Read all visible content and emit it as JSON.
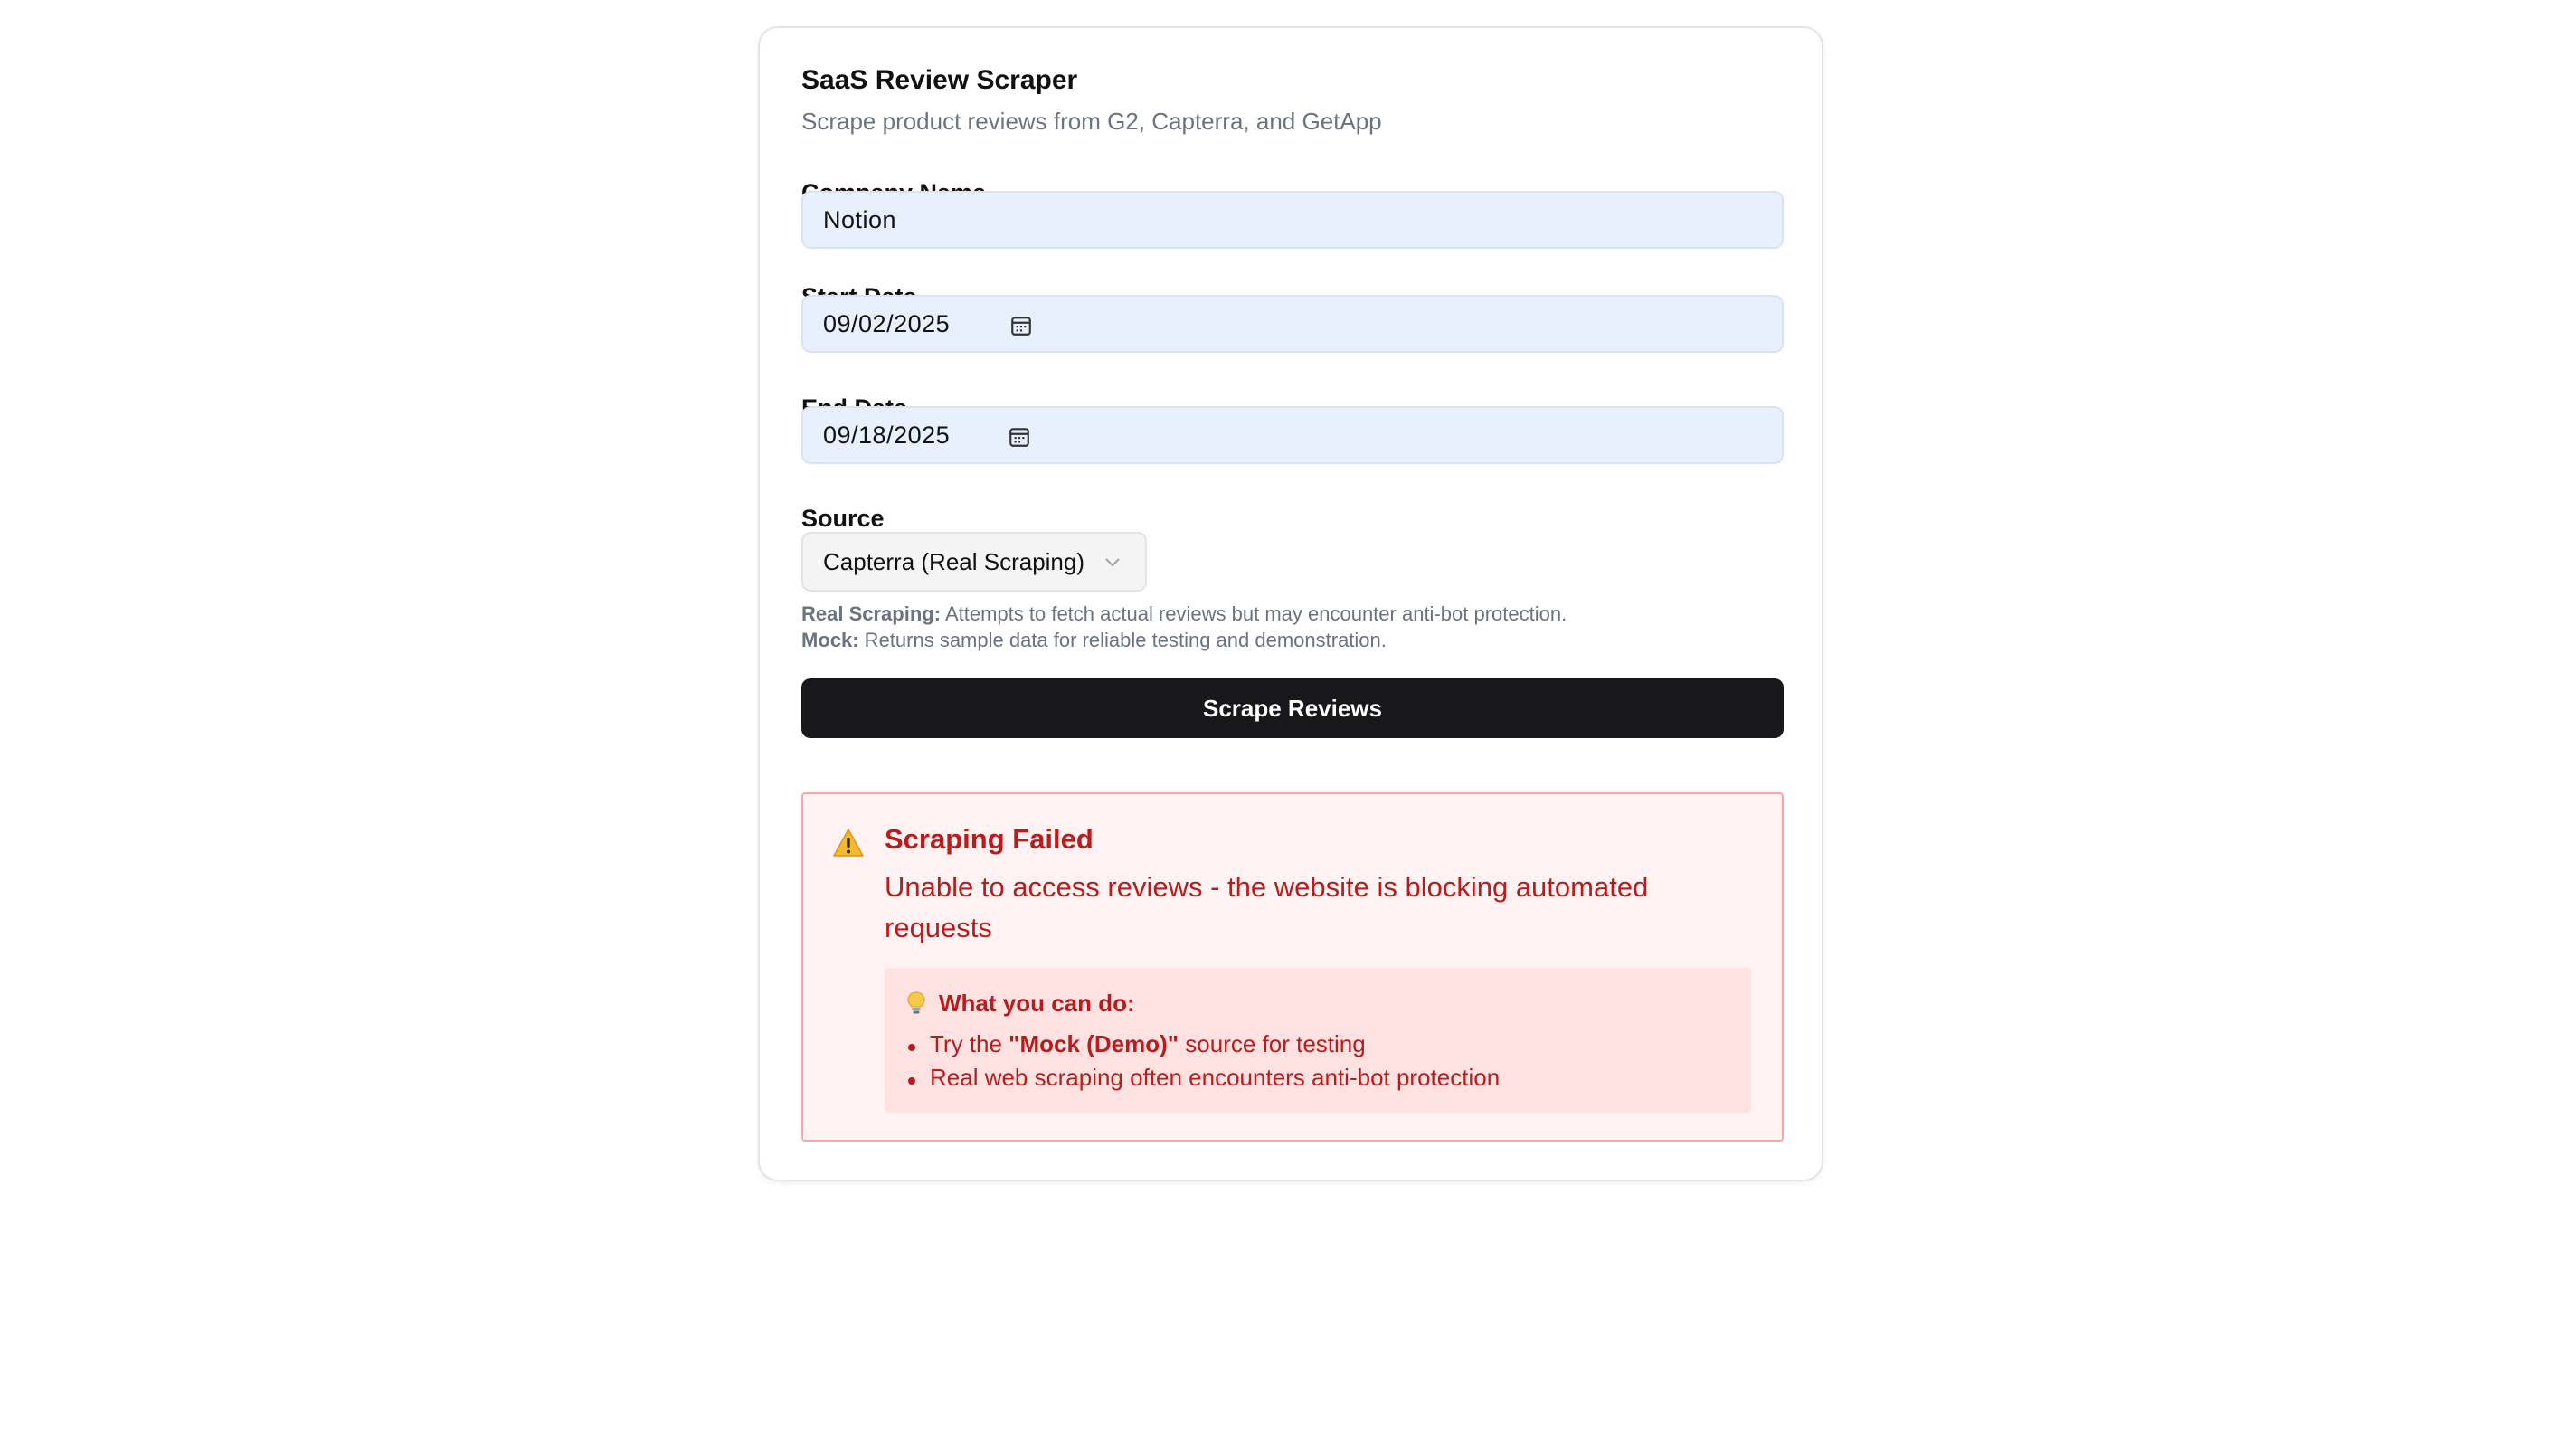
{
  "app": {
    "title": "SaaS Review Scraper",
    "subtitle": "Scrape product reviews from G2, Capterra, and GetApp"
  },
  "form": {
    "company": {
      "label": "Company Name",
      "value": "Notion"
    },
    "start_date": {
      "label": "Start Date",
      "value": "09/02/2025",
      "icon": "calendar-icon"
    },
    "end_date": {
      "label": "End Date",
      "value": "09/18/2025",
      "icon": "calendar-icon"
    },
    "source": {
      "label": "Source",
      "value": "Capterra (Real Scraping)",
      "icon": "chevron-down-icon"
    },
    "notes": {
      "real_label": "Real Scraping:",
      "real_text": " Attempts to fetch actual reviews but may encounter anti-bot protection.",
      "mock_label": "Mock:",
      "mock_text": " Returns sample data for reliable testing and demonstration."
    },
    "submit_label": "Scrape Reviews"
  },
  "error": {
    "icon": "warning-icon",
    "title": "Scraping Failed",
    "message": "Unable to access reviews - the website is blocking automated requests",
    "tips": {
      "icon": "lightbulb-icon",
      "title": "What you can do:",
      "item1_prefix": "Try the ",
      "item1_bold": "\"Mock (Demo)\"",
      "item1_suffix": " source for testing",
      "item2": "Real web scraping often encounters anti-bot protection"
    }
  },
  "colors": {
    "accent_button": "#18181b",
    "input_bg": "#e8f0fe",
    "error_text": "#b91c1c",
    "error_bg": "#fef2f2",
    "error_border": "#fca5a5"
  }
}
